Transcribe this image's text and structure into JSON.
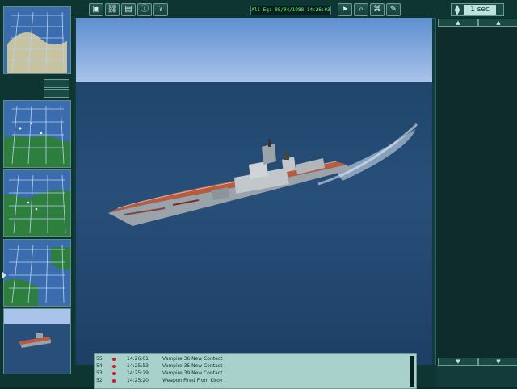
{
  "toolbar": {
    "date_time": "All Eq: 08/04/1988  14:26:03",
    "time_compression": "1 sec",
    "icons": [
      {
        "name": "cube-icon",
        "glyph": "▣"
      },
      {
        "name": "chain-icon",
        "glyph": "⛓"
      },
      {
        "name": "document-icon",
        "glyph": "▤"
      },
      {
        "name": "info-icon",
        "glyph": "ⓘ"
      },
      {
        "name": "help-icon",
        "glyph": "?"
      },
      {
        "name": "pointer-icon",
        "glyph": "➤"
      },
      {
        "name": "magnify-icon",
        "glyph": "⌕"
      },
      {
        "name": "map-icon",
        "glyph": "⌘"
      },
      {
        "name": "pen-icon",
        "glyph": "✎"
      }
    ]
  },
  "log": {
    "entries": [
      {
        "id": "55",
        "time": "14:26:01",
        "message": "Vampire 36 New Contact"
      },
      {
        "id": "54",
        "time": "14:25:53",
        "message": "Vampire 35 New Contact"
      },
      {
        "id": "53",
        "time": "14:25:29",
        "message": "Vampire 39 New Contact"
      },
      {
        "id": "52",
        "time": "14:25:20",
        "message": "Weapon Fired From Kirov"
      }
    ]
  },
  "colors": {
    "frame": "#0f3533",
    "accent": "#66ff66",
    "sea": "#284f79",
    "sky": "#a9c3ea",
    "ship_deck": "#b85b3f",
    "ship_hull": "#9aa2aa"
  }
}
